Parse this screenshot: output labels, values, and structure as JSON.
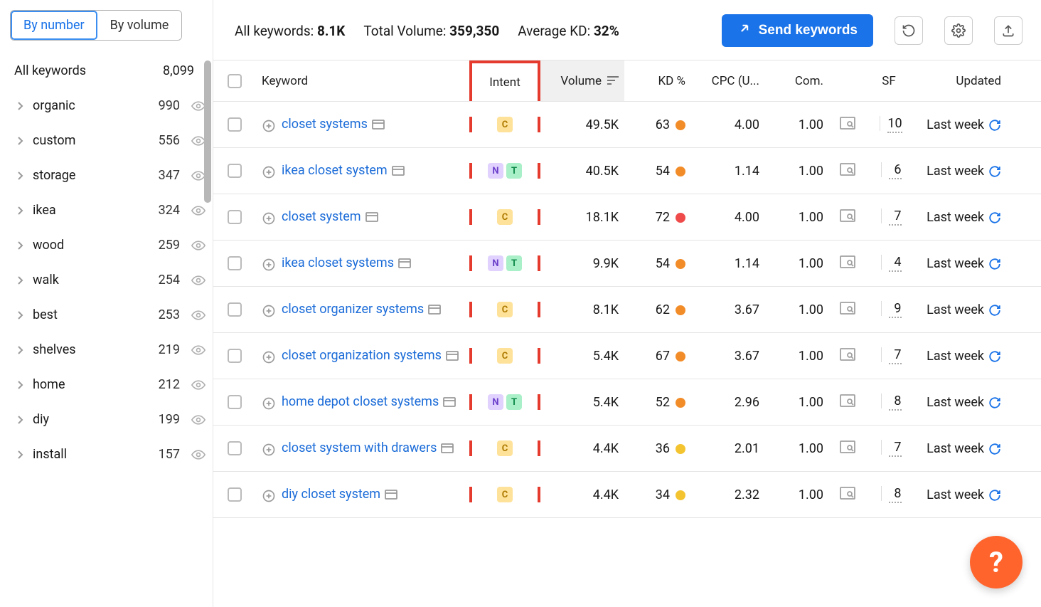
{
  "sidebar": {
    "toggle": {
      "by_number": "By number",
      "by_volume": "By volume"
    },
    "all_label": "All keywords",
    "all_count": "8,099",
    "groups": [
      {
        "name": "organic",
        "count": "990"
      },
      {
        "name": "custom",
        "count": "556"
      },
      {
        "name": "storage",
        "count": "347"
      },
      {
        "name": "ikea",
        "count": "324"
      },
      {
        "name": "wood",
        "count": "259"
      },
      {
        "name": "walk",
        "count": "254"
      },
      {
        "name": "best",
        "count": "253"
      },
      {
        "name": "shelves",
        "count": "219"
      },
      {
        "name": "home",
        "count": "212"
      },
      {
        "name": "diy",
        "count": "199"
      },
      {
        "name": "install",
        "count": "157"
      }
    ]
  },
  "topbar": {
    "stats": {
      "all_kw_label": "All keywords: ",
      "all_kw_val": "8.1K",
      "total_vol_label": "Total Volume: ",
      "total_vol_val": "359,350",
      "avg_kd_label": "Average KD: ",
      "avg_kd_val": "32%"
    },
    "send_btn": "Send keywords"
  },
  "columns": {
    "keyword": "Keyword",
    "intent": "Intent",
    "volume": "Volume",
    "kd": "KD %",
    "cpc": "CPC (U...",
    "com": "Com.",
    "sf": "SF",
    "updated": "Updated"
  },
  "rows": [
    {
      "kw": "closet systems",
      "intents": [
        "C"
      ],
      "vol": "49.5K",
      "kd": "63",
      "kdcolor": "#f28c28",
      "cpc": "4.00",
      "com": "1.00",
      "sf": "10",
      "upd": "Last week"
    },
    {
      "kw": "ikea closet system",
      "intents": [
        "N",
        "T"
      ],
      "vol": "40.5K",
      "kd": "54",
      "kdcolor": "#f28c28",
      "cpc": "1.14",
      "com": "1.00",
      "sf": "6",
      "upd": "Last week"
    },
    {
      "kw": "closet system",
      "intents": [
        "C"
      ],
      "vol": "18.1K",
      "kd": "72",
      "kdcolor": "#ef4b4b",
      "cpc": "4.00",
      "com": "1.00",
      "sf": "7",
      "upd": "Last week"
    },
    {
      "kw": "ikea closet systems",
      "intents": [
        "N",
        "T"
      ],
      "vol": "9.9K",
      "kd": "54",
      "kdcolor": "#f28c28",
      "cpc": "1.14",
      "com": "1.00",
      "sf": "4",
      "upd": "Last week"
    },
    {
      "kw": "closet organizer systems",
      "intents": [
        "C"
      ],
      "vol": "8.1K",
      "kd": "62",
      "kdcolor": "#f28c28",
      "cpc": "3.67",
      "com": "1.00",
      "sf": "9",
      "upd": "Last week"
    },
    {
      "kw": "closet organization systems",
      "intents": [
        "C"
      ],
      "vol": "5.4K",
      "kd": "67",
      "kdcolor": "#f28c28",
      "cpc": "3.67",
      "com": "1.00",
      "sf": "7",
      "upd": "Last week"
    },
    {
      "kw": "home depot closet systems",
      "intents": [
        "N",
        "T"
      ],
      "vol": "5.4K",
      "kd": "52",
      "kdcolor": "#f28c28",
      "cpc": "2.96",
      "com": "1.00",
      "sf": "8",
      "upd": "Last week"
    },
    {
      "kw": "closet system with drawers",
      "intents": [
        "C"
      ],
      "vol": "4.4K",
      "kd": "36",
      "kdcolor": "#f4c430",
      "cpc": "2.01",
      "com": "1.00",
      "sf": "7",
      "upd": "Last week"
    },
    {
      "kw": "diy closet system",
      "intents": [
        "C"
      ],
      "vol": "4.4K",
      "kd": "34",
      "kdcolor": "#f4c430",
      "cpc": "2.32",
      "com": "1.00",
      "sf": "8",
      "upd": "Last week"
    }
  ]
}
